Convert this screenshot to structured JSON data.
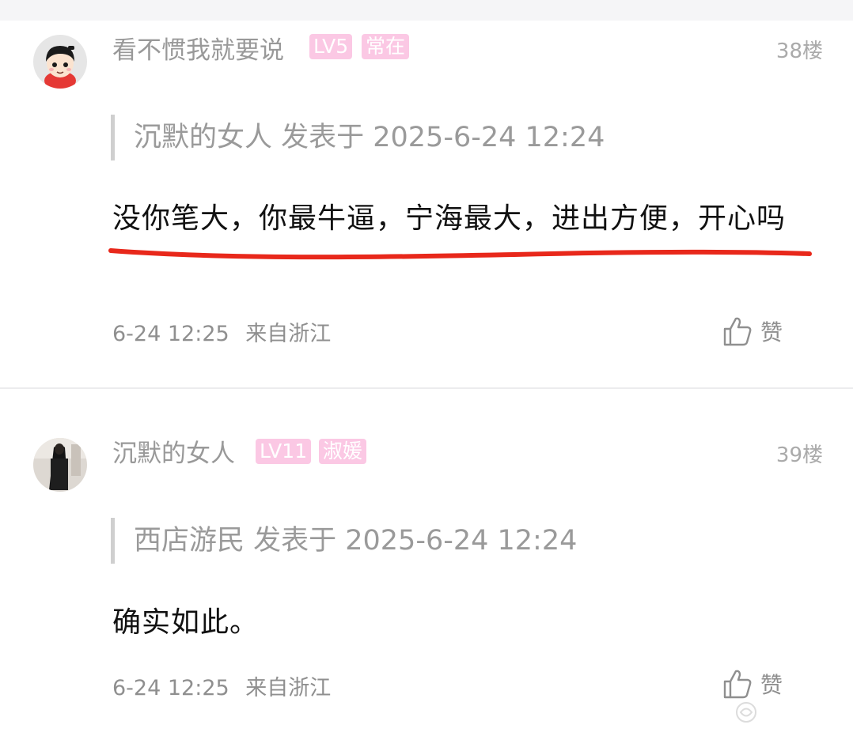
{
  "posts": [
    {
      "username": "看不惯我就要说",
      "badges": [
        "LV5",
        "常在"
      ],
      "floor": "38楼",
      "quote": "沉默的女人 发表于 2025-6-24 12:24",
      "body": "没你笔大，你最牛逼，宁海最大，进出方便，开心吗",
      "time": "6-24 12:25",
      "location": "来自浙江",
      "like_label": "赞"
    },
    {
      "username": "沉默的女人",
      "badges": [
        "LV11",
        "淑媛"
      ],
      "floor": "39楼",
      "quote": "西店游民 发表于 2025-6-24 12:24",
      "body": "确实如此。",
      "time": "6-24 12:25",
      "location": "来自浙江",
      "like_label": "赞"
    }
  ],
  "colors": {
    "badge": "#fbc8e4",
    "username": "#999999",
    "underline": "#e8281b"
  },
  "icons": [
    "avatar-cartoon",
    "avatar-photo",
    "thumbs-up-icon",
    "watermark-logo"
  ]
}
